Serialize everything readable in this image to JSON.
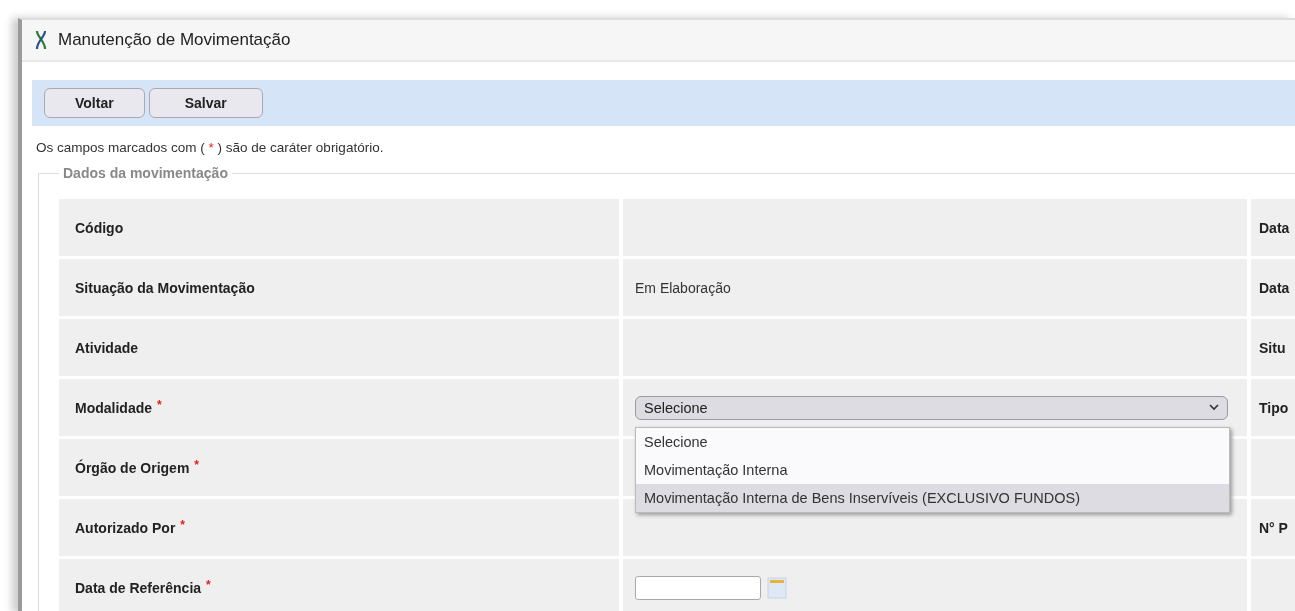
{
  "window": {
    "title": "Manutenção de Movimentação"
  },
  "toolbar": {
    "buttons": [
      "Voltar",
      "Salvar"
    ]
  },
  "required_note": {
    "before": "Os campos marcados com (",
    "mark": "*",
    "after": ") são de caráter obrigatório."
  },
  "fieldset": {
    "legend": "Dados da movimentação"
  },
  "rows": [
    {
      "label": "Código",
      "required": false,
      "kind": "text",
      "value": "",
      "column_3": "Data"
    },
    {
      "label": "Situação da Movimentação",
      "required": false,
      "kind": "text",
      "value": "Em Elaboração",
      "column_3": "Data"
    },
    {
      "label": "Atividade",
      "required": false,
      "kind": "text",
      "value": "",
      "column_3": "Situ"
    },
    {
      "label": "Modalidade",
      "required": true,
      "kind": "select",
      "value": "Selecione",
      "column_3": "Tipo"
    },
    {
      "label": "Órgão de Origem",
      "required": true,
      "kind": "text",
      "value": "",
      "column_3": ""
    },
    {
      "label": "Autorizado Por",
      "required": true,
      "kind": "text",
      "value": "",
      "column_3": "N° P"
    },
    {
      "label": "Data de Referência",
      "required": true,
      "kind": "date",
      "value": "",
      "column_3": ""
    }
  ],
  "dropdown": {
    "options": [
      {
        "label": "Selecione",
        "selected": false
      },
      {
        "label": "Movimentação Interna",
        "selected": false
      },
      {
        "label": "Movimentação Interna de Bens Inservíveis (EXCLUSIVO FUNDOS)",
        "selected": true
      }
    ]
  }
}
